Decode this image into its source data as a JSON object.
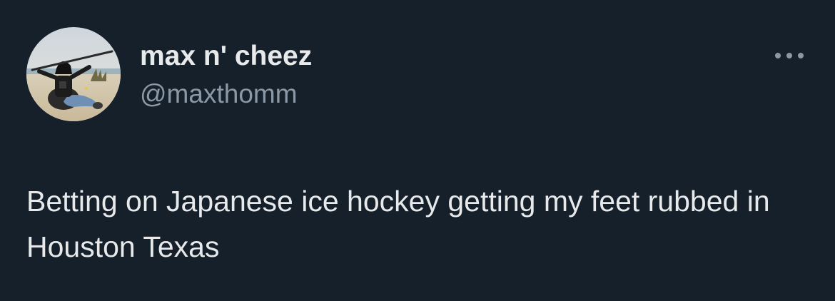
{
  "tweet": {
    "author": {
      "display_name": "max n' cheez",
      "handle": "@maxthomm",
      "avatar_icon": "avatar-photo-icon"
    },
    "more_icon": "more-options-icon",
    "text": "Betting on Japanese ice hockey getting my feet rubbed in Houston Texas"
  },
  "colors": {
    "background": "#15202b",
    "primary_text": "#e7e9ea",
    "secondary_text": "#8b98a5"
  }
}
